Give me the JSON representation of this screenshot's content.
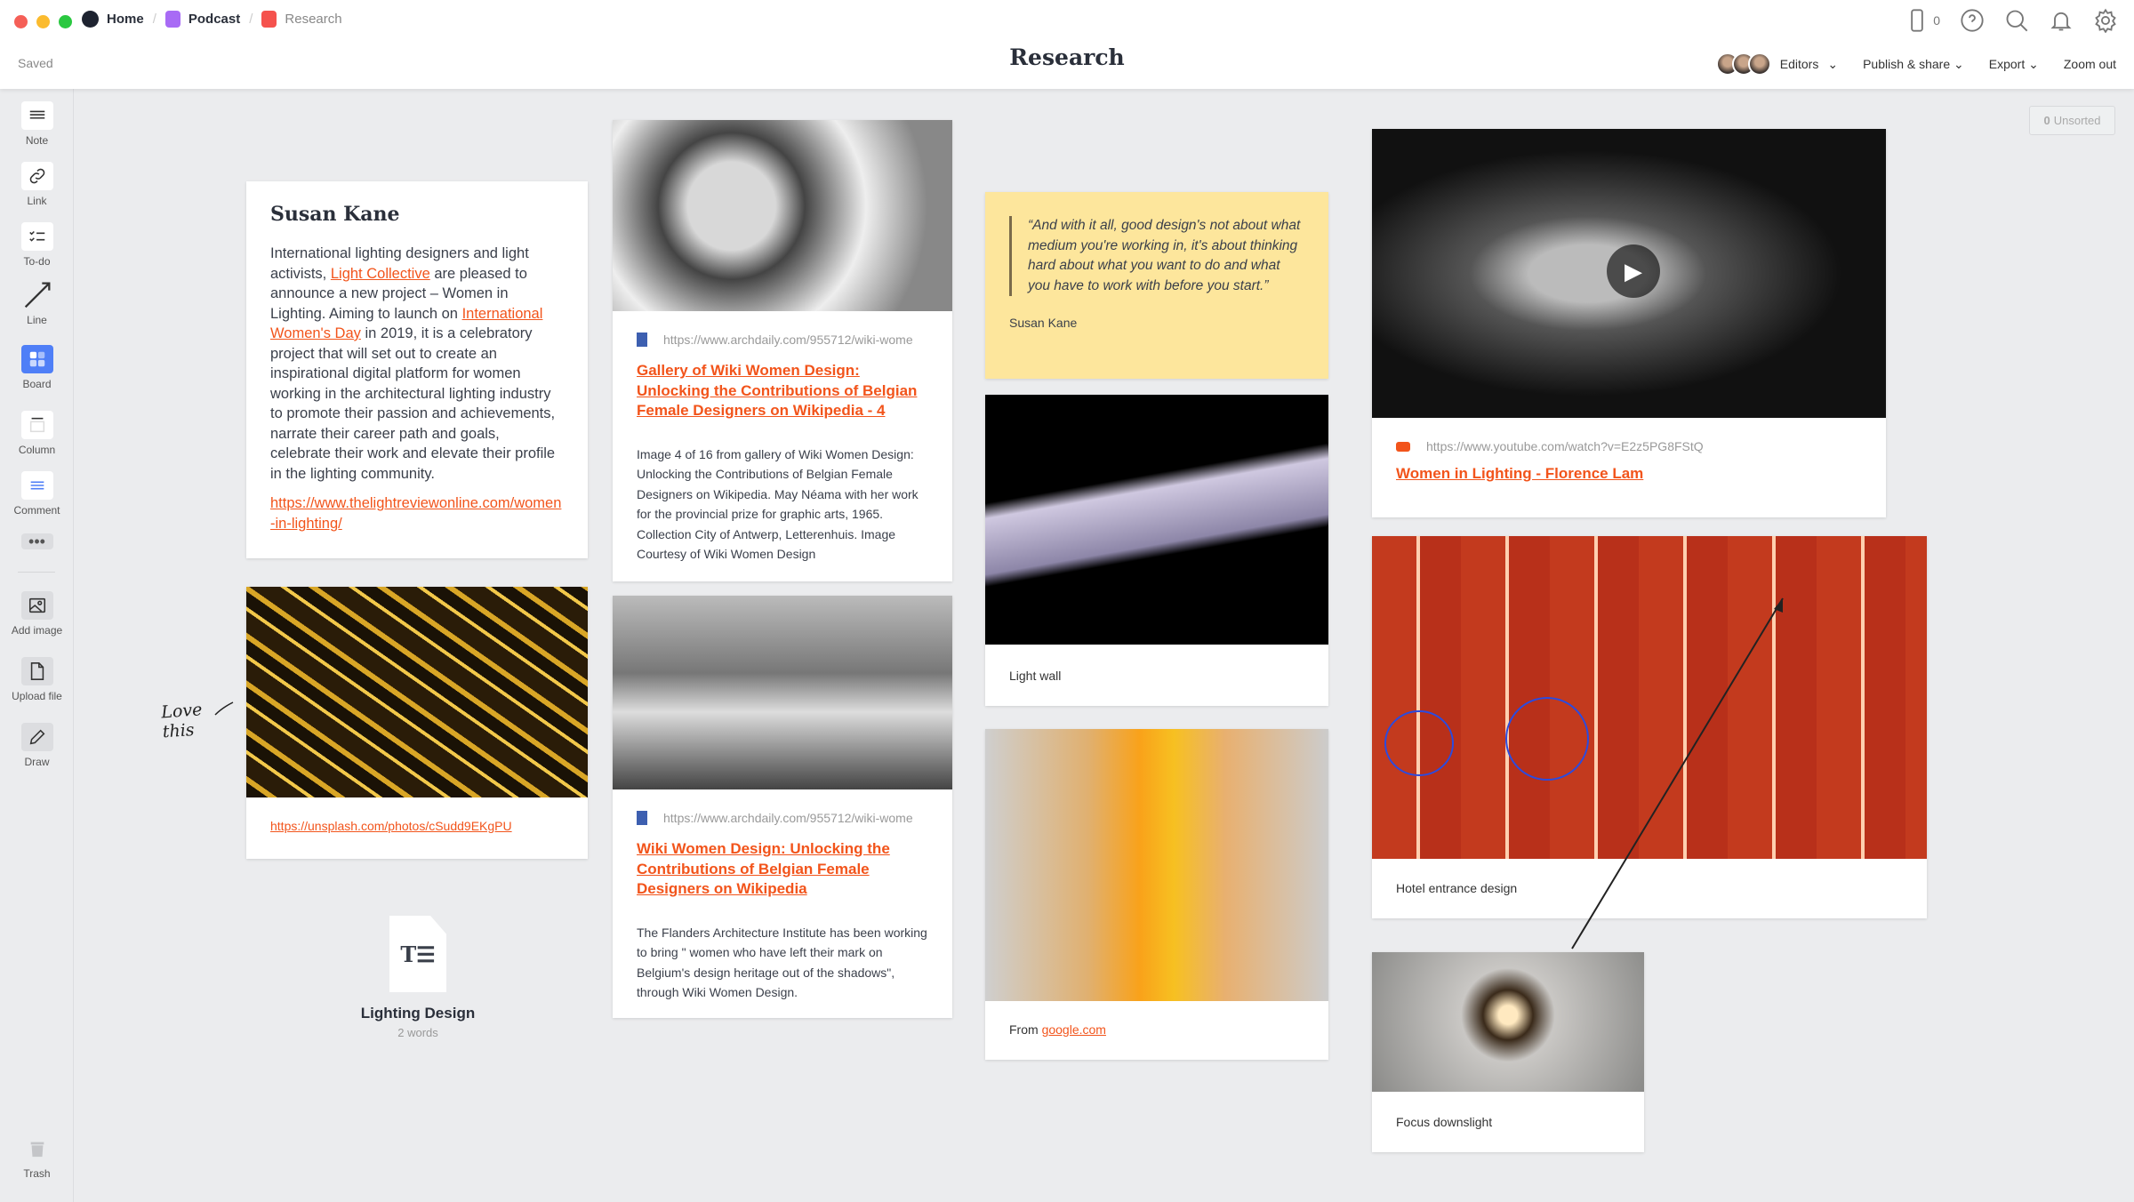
{
  "window": {
    "breadcrumbs": [
      {
        "label": "Home",
        "color": "#1e2330"
      },
      {
        "label": "Podcast",
        "color": "#a86bf5"
      },
      {
        "label": "Research",
        "color": "#f5524d"
      }
    ],
    "status": "Saved",
    "title": "Research"
  },
  "topbar": {
    "device_count": "0",
    "icons": [
      "phone-icon",
      "help-icon",
      "search-icon",
      "bell-icon",
      "gear-icon"
    ],
    "menu": {
      "editors": "Editors",
      "publish": "Publish & share",
      "export": "Export",
      "zoom": "Zoom out"
    }
  },
  "sidebar": {
    "items": [
      {
        "label": "Note",
        "icon": "note-icon"
      },
      {
        "label": "Link",
        "icon": "link-icon"
      },
      {
        "label": "To-do",
        "icon": "todo-icon"
      },
      {
        "label": "Line",
        "icon": "line-icon"
      },
      {
        "label": "Board",
        "icon": "board-icon"
      },
      {
        "label": "Column",
        "icon": "column-icon"
      },
      {
        "label": "Comment",
        "icon": "comment-icon"
      },
      {
        "label": "Add image",
        "icon": "image-icon"
      },
      {
        "label": "Upload file",
        "icon": "file-icon"
      },
      {
        "label": "Draw",
        "icon": "pencil-icon"
      }
    ],
    "trash": "Trash"
  },
  "unsorted": {
    "count": "0",
    "label": "Unsorted"
  },
  "accent": "#f2541b",
  "cards": {
    "susan": {
      "title": "Susan Kane",
      "t1": "International lighting designers and light activists, ",
      "l1": "Light Collective",
      "t2": " are pleased to announce a new project – Women in Lighting.  Aiming to launch on ",
      "l2": "International Women's Day",
      "t3": " in 2019, it is a celebratory project that will set out to create an inspirational digital platform for women working in the architectural lighting industry to promote their passion and achievements, narrate their career path and goals, celebrate their work and elevate their profile in the lighting community.",
      "url": "https://www.thelightreviewonline.com/women-in-lighting/"
    },
    "gold": {
      "url": "https://unsplash.com/photos/cSudd9EKgPU",
      "handwriting": "Love this"
    },
    "doc": {
      "title": "Lighting Design",
      "words": "2 words"
    },
    "wiki1": {
      "url": "https://www.archdaily.com/955712/wiki-wome",
      "title": "Gallery of Wiki Women Design: Unlocking the Contributions of Belgian Female Designers on Wikipedia - 4",
      "desc": "Image 4 of 16 from gallery of Wiki Women Design: Unlocking the Contributions of Belgian Female Designers on Wikipedia. May Néama with her work for the provincial prize for graphic arts, 1965. Collection City of Antwerp, Letterenhuis. Image Courtesy of Wiki Women Design"
    },
    "wiki2": {
      "url": "https://www.archdaily.com/955712/wiki-wome",
      "title": "Wiki Women Design: Unlocking the Contributions of Belgian Female Designers on Wikipedia",
      "desc": "The Flanders Architecture Institute has been working to bring \" women who have left their mark on Belgium's design heritage out of the shadows\", through Wiki Women Design."
    },
    "quote": {
      "text": "“And with it all, good design's not about what medium you're working in, it's about thinking hard about what you want to do and what you have to work with before you start.”",
      "author": "Susan Kane"
    },
    "lightwall": {
      "caption": "Light wall"
    },
    "google": {
      "prefix": "From ",
      "link": "google.com"
    },
    "video": {
      "url": "https://www.youtube.com/watch?v=E2z5PG8FStQ",
      "title": "Women in Lighting - Florence Lam"
    },
    "hotel": {
      "caption": "Hotel entrance design"
    },
    "focus": {
      "caption": "Focus downslight"
    }
  }
}
